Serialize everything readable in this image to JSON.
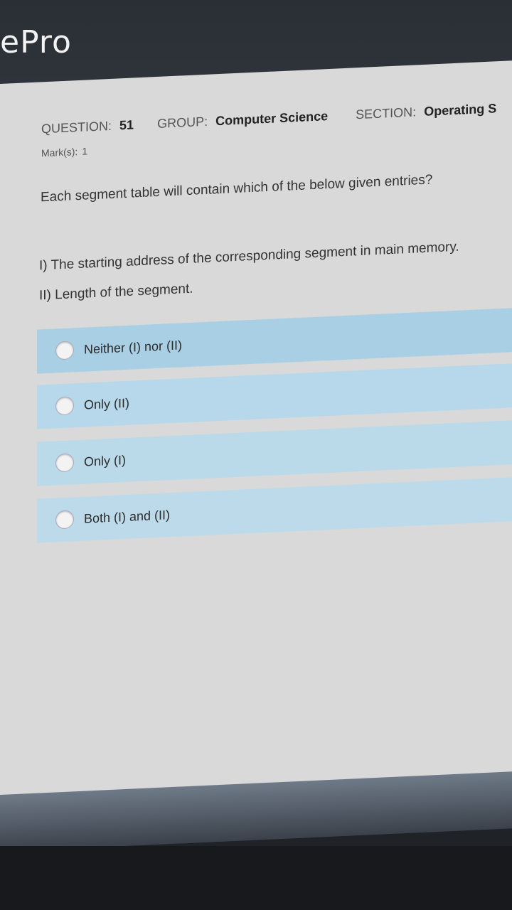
{
  "app": {
    "brand": "ePro"
  },
  "question_header": {
    "question_label": "QUESTION:",
    "question_number": "51",
    "group_label": "GROUP:",
    "group_value": "Computer Science",
    "section_label": "SECTION:",
    "section_value": "Operating S",
    "marks_label": "Mark(s):",
    "marks_value": "1"
  },
  "question": {
    "text": "Each segment table will contain which of the below given entries?",
    "statements": [
      "I) The starting address of the corresponding segment in main memory.",
      "II) Length of the segment."
    ]
  },
  "options": [
    {
      "label": "Neither (I) nor (II)"
    },
    {
      "label": "Only (II)"
    },
    {
      "label": "Only (I)"
    },
    {
      "label": "Both (I) and (II)"
    }
  ],
  "colors": {
    "page": "#d9d9d9",
    "option_bg": "#b7d8ea",
    "topbar": "#2c3137"
  }
}
